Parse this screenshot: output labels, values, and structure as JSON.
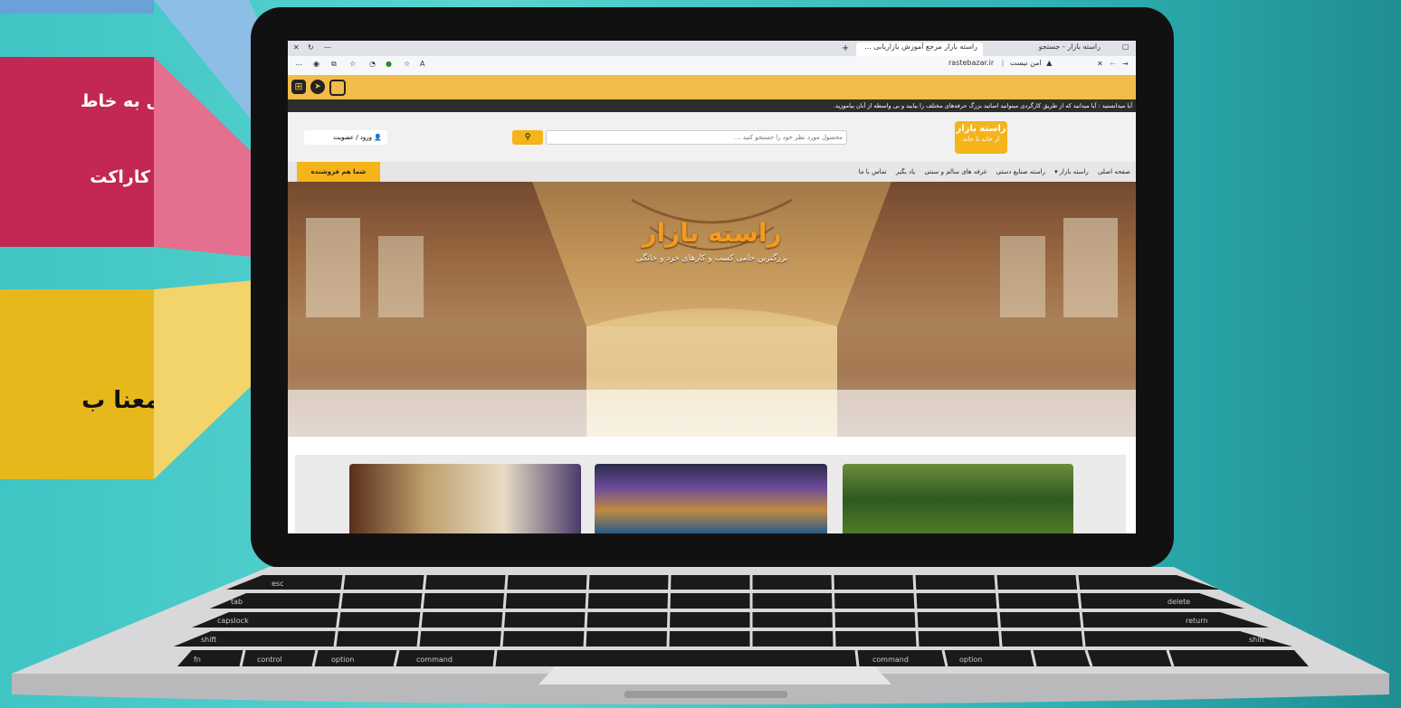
{
  "callouts": {
    "pink_line1": "قابل به خاط",
    "pink_line2": "باید کاراکت",
    "yellow_line1": "با معنا ب"
  },
  "browser": {
    "tabs": [
      {
        "label": "راسته بازار - جستجو"
      },
      {
        "label": "راسته بازار مرجع آموزش بازاریابی ..."
      }
    ],
    "url": "rastebazar.ir",
    "security_label": "امن نیست"
  },
  "site": {
    "notice": "آیا میدانستید : آیا میدانید که از طریق کارگردی میتوانید اساتید بزرگ حرفه‌های مختلف را بیابید و بی واسطه از آنان بیاموزید.",
    "search_placeholder": "محصول مورد نظر خود را جستجو کنید ...",
    "login_label": "ورود / عضویت",
    "logo_line1": "راسته بازار",
    "logo_line2": "از خانه تا خانه",
    "seller_button": "شما هم فروشنده",
    "nav_items": [
      "صفحه اصلی",
      "راسته بازار",
      "راسته صنایع دستی",
      "غرفه های سالم و سنتی",
      "یاد بگیر",
      "تماس با ما"
    ],
    "hero_title": "راسته بازار",
    "hero_subtitle": "بزرگترین حامی کسب و کارهای خرد و خانگی"
  },
  "keyboard": {
    "row_labels": [
      "esc",
      "tab",
      "capslock",
      "shift",
      "fn",
      "control",
      "option",
      "command",
      "command",
      "option",
      "shift",
      "return",
      "delete"
    ]
  }
}
